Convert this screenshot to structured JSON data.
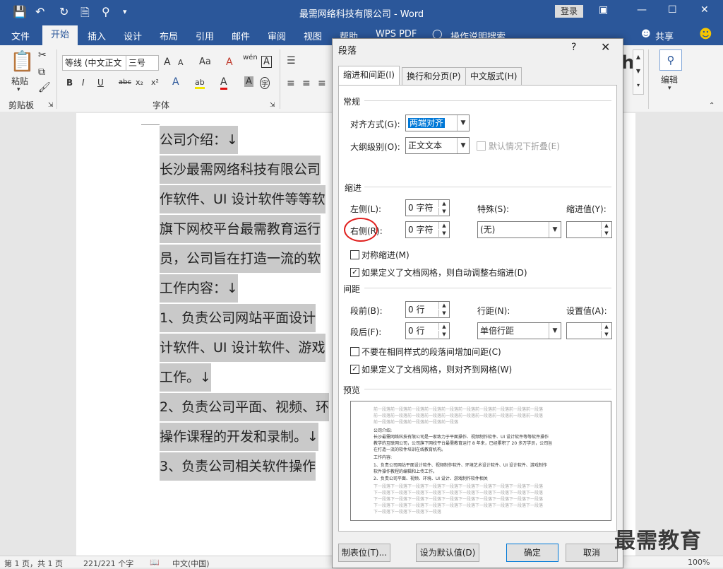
{
  "window": {
    "title": "最需网络科技有限公司 - Word",
    "login_label": "登录",
    "minimize": "—",
    "restore": "☐",
    "close": "✕"
  },
  "ribbon_tabs": [
    {
      "label": "文件"
    },
    {
      "label": "开始"
    },
    {
      "label": "插入"
    },
    {
      "label": "设计"
    },
    {
      "label": "布局"
    },
    {
      "label": "引用"
    },
    {
      "label": "邮件"
    },
    {
      "label": "审阅"
    },
    {
      "label": "视图"
    },
    {
      "label": "帮助"
    },
    {
      "label": "WPS PDF"
    },
    {
      "label": "操作说明搜索"
    }
  ],
  "share_label": "共享",
  "ribbon": {
    "paste_label": "粘贴",
    "clipboard_label": "剪贴板",
    "font_name": "等线 (中文正文",
    "font_size": "三号",
    "font_group_label": "字体",
    "font_size_grow": "A",
    "font_size_shrink": "A",
    "change_case": "Aa",
    "clear_format": "A",
    "phonetic": "wén",
    "char_border": "A",
    "bold": "B",
    "italic": "I",
    "underline": "U",
    "strike": "abc",
    "subscript": "x₂",
    "superscript": "x²",
    "text_effect": "A",
    "highlight": "ab",
    "font_color": "A",
    "char_shading": "A",
    "enclose": "字",
    "edit_label": "编辑",
    "style_glyph": "h"
  },
  "document": {
    "lines": [
      "公司介绍：↓",
      "长沙最需网络科技有限公司",
      "作软件、UI 设计软件等等软",
      "旗下网校平台最需教育运行",
      "员，公司旨在打造一流的软",
      "工作内容：↓",
      "1、负责公司网站平面设计",
      "计软件、UI 设计软件、游戏",
      "工作。↓",
      "2、负责公司平面、视频、环",
      "操作课程的开发和录制。↓",
      "3、负责公司相关软件操作"
    ]
  },
  "status": {
    "page": "第 1 页，共 1 页",
    "words": "221/221 个字",
    "language": "中文(中国)",
    "zoom": "100%"
  },
  "dialog": {
    "title": "段落",
    "help": "?",
    "close": "✕",
    "tabs": [
      {
        "label": "缩进和间距(I)"
      },
      {
        "label": "换行和分页(P)"
      },
      {
        "label": "中文版式(H)"
      }
    ],
    "general": {
      "section": "常规",
      "alignment_label": "对齐方式(G):",
      "alignment_value": "两端对齐",
      "outline_label": "大纲级别(O):",
      "outline_value": "正文文本",
      "collapse_label": "默认情况下折叠(E)"
    },
    "indent": {
      "section": "缩进",
      "left_label": "左侧(L):",
      "left_value": "0 字符",
      "right_label": "右侧(R):",
      "right_value": "0 字符",
      "special_label": "特殊(S):",
      "special_value": "(无)",
      "by_label": "缩进值(Y):",
      "by_value": "",
      "mirror_label": "对称缩进(M)",
      "mirror_checked": false,
      "auto_adjust_label": "如果定义了文档网格，则自动调整右缩进(D)",
      "auto_adjust_checked": true
    },
    "spacing": {
      "section": "间距",
      "before_label": "段前(B):",
      "before_value": "0 行",
      "after_label": "段后(F):",
      "after_value": "0 行",
      "line_label": "行距(N):",
      "line_value": "单倍行距",
      "at_label": "设置值(A):",
      "at_value": "",
      "no_space_label": "不要在相同样式的段落间增加间距(C)",
      "no_space_checked": false,
      "snap_grid_label": "如果定义了文档网格，则对齐到网格(W)",
      "snap_grid_checked": true
    },
    "preview": {
      "section": "预览",
      "prev_lines": [
        "前一段落前一段落前一段落前一段落前一段落前一段落前一段落前一段落前一段落前一段落",
        "前一段落前一段落前一段落前一段落前一段落前一段落前一段落前一段落前一段落前一段落",
        "前一段落前一段落前一段落前一段落前一段落"
      ],
      "body_lines": [
        "公司介绍:",
        "长沙最需网络科技有限公司是一家致力于平面操作、视频制作软件、UI 设计软件等等软件操作",
        "教学的互联网公司，公司旗下网校平台最需教育运行 8 年来，已经累积了 20 多万学员，公司旨",
        "在打造一流的软件培训在线教育机构。",
        "工作内容:",
        "1、负责公司网站平面设计软件、视频制作软件、环境艺术设计软件、UI 设计软件、游戏制作",
        "软件操作教程的编辑和上传工作。",
        "2、负责公司平面、视频、环境、UI 设计、游戏制作软件相关"
      ],
      "next_lines": [
        "下一段落下一段落下一段落下一段落下一段落下一段落下一段落下一段落下一段落下一段落",
        "下一段落下一段落下一段落下一段落下一段落下一段落下一段落下一段落下一段落下一段落",
        "下一段落下一段落下一段落下一段落下一段落下一段落下一段落下一段落下一段落下一段落",
        "下一段落下一段落下一段落下一段落下一段落下一段落下一段落下一段落下一段落下一段落",
        "下一段落下一段落下一段落下一段落"
      ]
    },
    "buttons": {
      "tabs": "制表位(T)...",
      "default": "设为默认值(D)",
      "ok": "确定",
      "cancel": "取消"
    }
  },
  "watermark": "最需教育",
  "colors": {
    "title_bar": "#2b579a",
    "selection": "#0078d7",
    "annotation_circle": "#e0201e"
  }
}
